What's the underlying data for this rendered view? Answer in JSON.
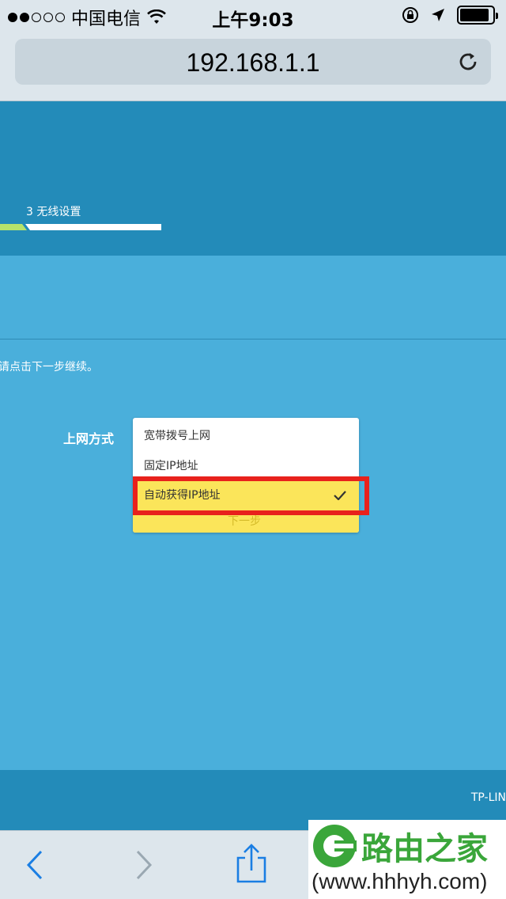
{
  "status_bar": {
    "signal_dots": [
      "full",
      "full",
      "empty",
      "empty",
      "empty"
    ],
    "carrier": "中国电信",
    "wifi_icon": "wifi-icon",
    "time": "上午9:03",
    "lock_rotation_icon": "lock-rotation-icon",
    "location_icon": "location-arrow-icon",
    "battery_icon": "battery-icon",
    "battery_level": 0.9
  },
  "browser": {
    "url": "192.168.1.1",
    "reload_icon": "reload-icon"
  },
  "wizard": {
    "step_label": "3 无线设置",
    "hint": "请点击下一步继续。",
    "field_label": "上网方式",
    "options": [
      "宽带拨号上网",
      "固定IP地址",
      "自动获得IP地址"
    ],
    "selected_option": "自动获得IP地址",
    "under_button_text": "下一步",
    "footer_brand": "TP-LIN"
  },
  "toolbar": {
    "back_icon": "back-chevron-icon",
    "forward_icon": "forward-chevron-icon",
    "share_icon": "share-icon"
  },
  "watermark": {
    "title": "路由之家",
    "url": "(www.hhhyh.com)"
  },
  "colors": {
    "header_blue": "#238bb9",
    "content_blue": "#4aafdb",
    "selected_yellow": "#fbe55a",
    "highlight_red": "#e8211c",
    "progress_green": "#b6e36b"
  }
}
